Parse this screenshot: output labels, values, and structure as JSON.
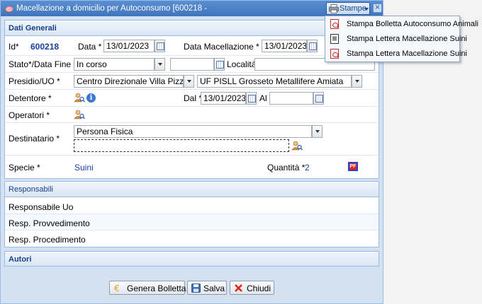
{
  "window": {
    "title": "Macellazione a domicilio per Autoconsumo [600218 -",
    "stampe_label": "Stampe",
    "icon": "pig-icon",
    "close_icon": "close-icon"
  },
  "dati_generali": {
    "header": "Dati Generali",
    "id_label": "Id*",
    "id_value": "600218",
    "data_label": "Data *",
    "data_value": "13/01/2023",
    "data_macellazione_label": "Data Macellazione *",
    "data_macellazione_value": "13/01/2023",
    "stato_label": "Stato*/Data Fine",
    "stato_value": "In corso",
    "data_fine_value": "",
    "localita_label": "Località",
    "localita_value": "",
    "presidio_label": "Presidio/UO *",
    "presidio_value": "Centro Direzionale Villa Pizzetti",
    "uo_value": "UF PISLL Grosseto Metallifere Amiata",
    "detentore_label": "Detentore *",
    "dal_label": "Dal *",
    "dal_value": "13/01/2023",
    "al_label": "Al",
    "al_value": "",
    "operatori_label": "Operatori *",
    "destinatario_label": "Destinatario *",
    "destinatario_tipo": "Persona Fisica",
    "destinatario_value": "",
    "specie_label": "Specie *",
    "specie_value": "Suini",
    "quantita_label": "Quantità *",
    "quantita_value": "2"
  },
  "responsabili": {
    "header": "Responsabili",
    "rows": [
      "Responsabile Uo",
      "Resp. Provvedimento",
      "Resp. Procedimento"
    ]
  },
  "autori": {
    "header": "Autori"
  },
  "buttons": {
    "genera_bolletta": "Genera Bolletta",
    "salva": "Salva",
    "chiudi": "Chiudi"
  },
  "stampe_menu": {
    "items": [
      {
        "label": "Stampa Bolletta Autoconsumo Animali",
        "icon": "pdf-icon"
      },
      {
        "label": "Stampa Lettera Macellazione Suini",
        "icon": "document-icon"
      },
      {
        "label": "Stampa Lettera Macellazione Suini",
        "icon": "pdf-icon"
      }
    ]
  },
  "colors": {
    "title_bar": "#3f74bd",
    "panel_header_text": "#15428b",
    "value_blue": "#1a3fa0"
  }
}
